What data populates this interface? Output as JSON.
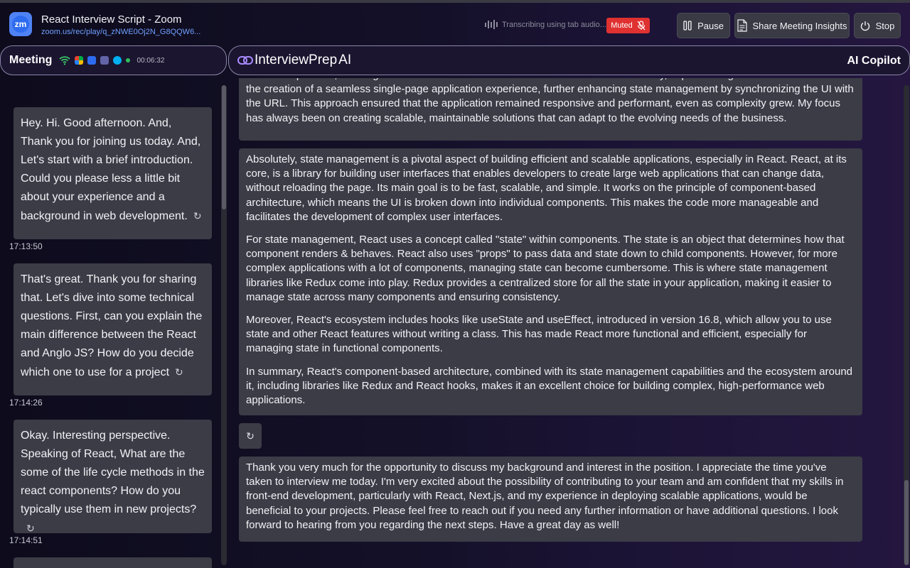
{
  "header": {
    "title": "React Interview Script - Zoom",
    "url": "zoom.us/rec/play/q_zNWE0Oj2N_G8QQW6...",
    "app_icon_text": "zm",
    "transcribing": "Transcribing using tab audio...",
    "muted_label": "Muted",
    "pause_label": "Pause",
    "share_label": "Share Meeting Insights",
    "stop_label": "Stop"
  },
  "meeting": {
    "label": "Meeting",
    "timer": "00:06:32"
  },
  "copilot": {
    "brand": "InterviewPrep",
    "brand_suffix": "AI",
    "label": "AI Copilot"
  },
  "transcript": [
    {
      "text": "Hey. Hi. Good afternoon. And, Thank you for joining us today. And, Let's start with a brief introduction. Could you please less a little bit about your experience and a background in web development.",
      "time": "17:13:50"
    },
    {
      "text": "That's great. Thank you for sharing that. Let's dive into some technical questions. First, can you explain the main difference between the React and Anglo JS? How do you decide which one to use for a project",
      "time": "17:14:26"
    },
    {
      "text": "Okay. Interesting perspective. Speaking of React, What are the some of the life cycle methods in the react components? How do you typically use them in new projects?",
      "time": "17:14:51"
    }
  ],
  "answers": {
    "partial": "within components, allowing for a more modular and maintainable codebase. Additionally, implementing React-Router enabled the creation of a seamless single-page application experience, further enhancing state management by synchronizing the UI with the URL. This approach ensured that the application remained responsive and performant, even as complexity grew. My focus has always been on creating scalable, maintainable solutions that can adapt to the evolving needs of the business.",
    "state": [
      "Absolutely, state management is a pivotal aspect of building efficient and scalable applications, especially in React. React, at its core, is a library for building user interfaces that enables developers to create large web applications that can change data, without reloading the page. Its main goal is to be fast, scalable, and simple. It works on the principle of component-based architecture, which means the UI is broken down into individual components. This makes the code more manageable and facilitates the development of complex user interfaces.",
      "For state management, React uses a concept called \"state\" within components. The state is an object that determines how that component renders & behaves. React also uses \"props\" to pass data and state down to child components. However, for more complex applications with a lot of components, managing state can become cumbersome. This is where state management libraries like Redux come into play. Redux provides a centralized store for all the state in your application, making it easier to manage state across many components and ensuring consistency.",
      "Moreover, React's ecosystem includes hooks like useState and useEffect, introduced in version 16.8, which allow you to use state and other React features without writing a class. This has made React more functional and efficient, especially for managing state in functional components.",
      "In summary, React's component-based architecture, combined with its state management capabilities and the ecosystem around it, including libraries like Redux and React hooks, makes it an excellent choice for building complex, high-performance web applications."
    ],
    "closing": "Thank you very much for the opportunity to discuss my background and interest in the position. I appreciate the time you've taken to interview me today. I'm very excited about the possibility of contributing to your team and am confident that my skills in front-end development, particularly with React, Next.js, and my experience in deploying scalable applications, would be beneficial to your projects. Please feel free to reach out if you need any further information or have additional questions. I look forward to hearing from you regarding the next steps. Have a great day as well!"
  },
  "colors": {
    "accent": "#e03131",
    "zoom": "#2d6cf0",
    "card": "#3b3c46"
  }
}
